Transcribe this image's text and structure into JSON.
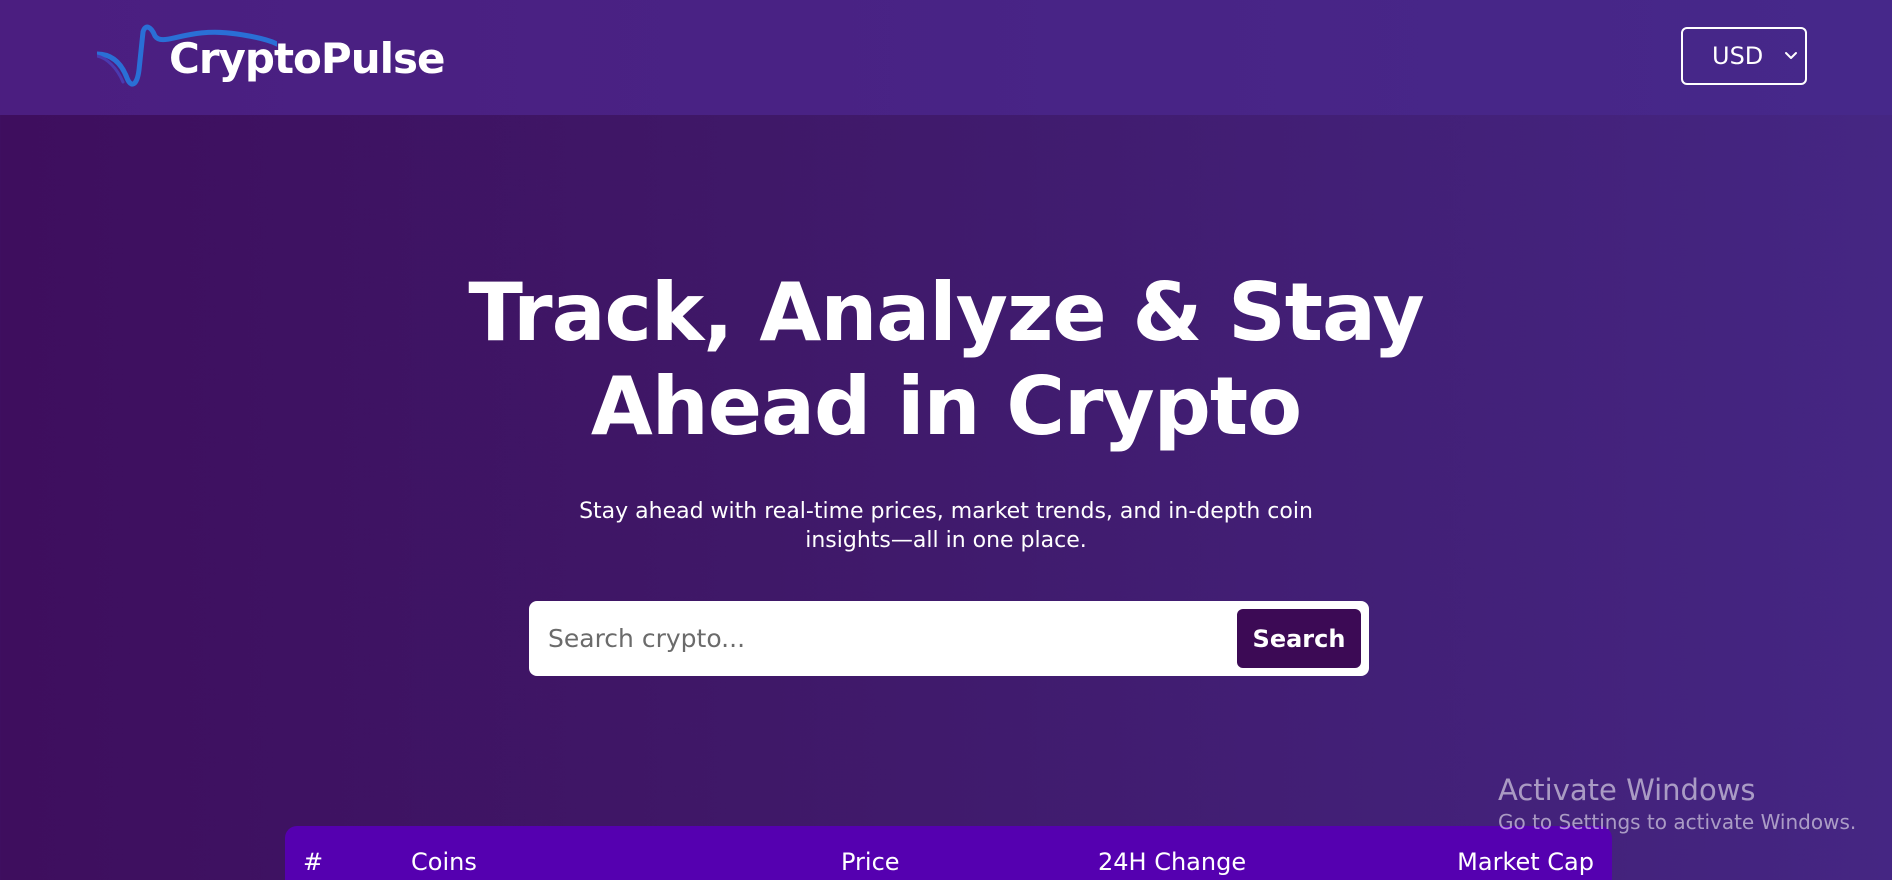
{
  "header": {
    "logo_text": "CryptoPulse",
    "currency": {
      "selected": "USD",
      "icon": "chevron-down-icon"
    }
  },
  "hero": {
    "title_line1": "Track, Analyze & Stay",
    "title_line2": "Ahead in Crypto",
    "subtitle_line1": "Stay ahead with real-time prices, market trends, and in-depth coin",
    "subtitle_line2": "insights—all in one place."
  },
  "search": {
    "placeholder": "Search crypto...",
    "value": "",
    "button_label": "Search"
  },
  "table": {
    "columns": [
      "#",
      "Coins",
      "Price",
      "24H Change",
      "Market Cap"
    ]
  },
  "watermark": {
    "title": "Activate Windows",
    "subtitle": "Go to Settings to activate Windows."
  },
  "colors": {
    "background_left": "#3e0e5e",
    "background_right": "#452683",
    "navbar": "#4b1e80",
    "search_button": "#3c0a55",
    "table_header": "#5500b0",
    "logo_wave": "#2a6fd6"
  }
}
